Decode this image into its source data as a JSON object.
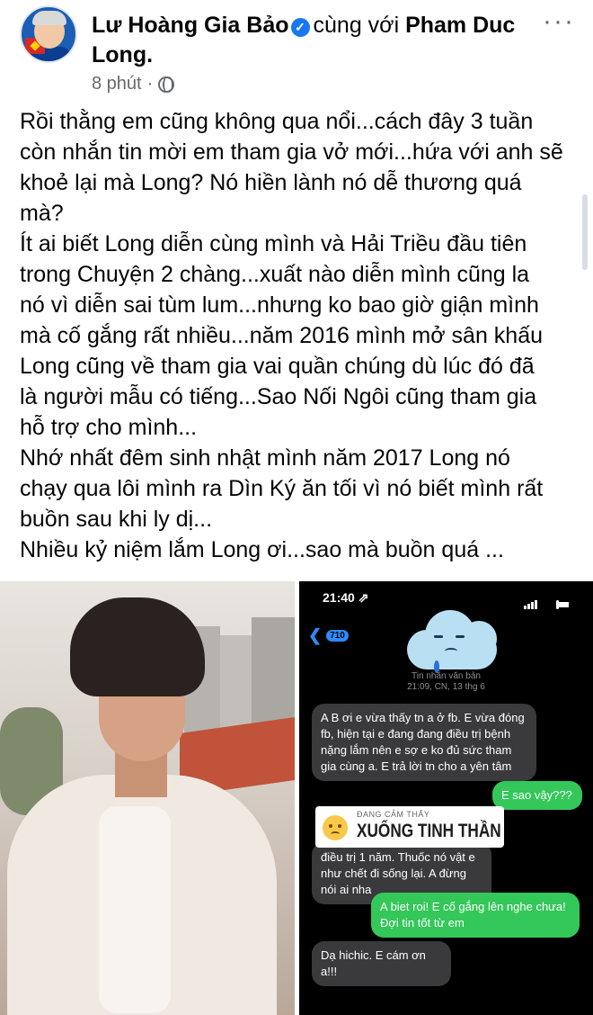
{
  "post": {
    "author": "Lư Hoàng Gia Bảo",
    "verified_icon": "✓",
    "with_text": "cùng với",
    "tagged": "Pham Duc",
    "tagged_cont": "Long.",
    "time": "8 phút",
    "separator": "·",
    "privacy_icon": "globe-icon",
    "more_label": "···",
    "text_lines": [
      "Rồi thằng em cũng không qua nổi...cách đây 3 tuần",
      "còn nhắn tin mời em tham gia vở mới...hứa với anh sẽ",
      "khoẻ lại mà Long? Nó hiền lành nó dễ thương quá",
      "mà?",
      "Ít ai biết Long diễn cùng mình và Hải Triều đầu tiên",
      "trong Chuyện 2 chàng...xuất nào diễn mình cũng la",
      "nó vì diễn sai tùm lum...nhưng ko bao giờ giận mình",
      "mà cố gắng rất nhiều...năm 2016 mình mở sân khấu",
      "Long cũng về tham gia vai quần chúng dù lúc đó đã",
      "là người mẫu có tiếng...Sao Nối Ngôi cũng tham gia",
      "hỗ trợ cho mình...",
      "Nhớ nhất đêm sinh nhật mình năm 2017 Long nó",
      "chạy qua lôi mình ra Dìn Ký ăn tối vì nó biết mình rất",
      "buồn sau khi ly dị...",
      "Nhiều kỷ niệm lắm Long ơi...sao mà buồn quá ..."
    ]
  },
  "phone": {
    "time": "21:40",
    "location_icon": "⇗",
    "back_arrow": "❮",
    "badge": "710",
    "meta_line1": "Tin nhắn văn bản",
    "meta_line2": "21:09, CN, 13 thg 6",
    "messages": [
      {
        "dir": "in",
        "text": "A B ơi e vừa thấy tn a ở fb. E vừa đóng fb, hiện tại e đang đang điều trị bệnh nặng lắm nên e sợ e ko đủ sức tham gia cùng a. E trả lời tn cho a yên tâm"
      },
      {
        "dir": "out",
        "text": "E sao vậy???"
      },
      {
        "dir": "in",
        "text": "điều trị 1 năm. Thuốc nó vật e như chết đi sống lại. A đừng nói ai nha"
      },
      {
        "dir": "out",
        "text": "A biet roi! E cố gắng lên nghe chưa! Đợi tin tốt từ em"
      },
      {
        "dir": "in",
        "text": "Dạ hichic. E cám ơn a!!!"
      }
    ],
    "feeling_small": "ĐANG CẢM THẤY",
    "feeling_big": "XUỐNG TINH THẦN"
  },
  "colors": {
    "accent": "#1877f2",
    "meta_gray": "#65676b",
    "bubble_in": "#3a3a3c",
    "bubble_out": "#34c759"
  }
}
